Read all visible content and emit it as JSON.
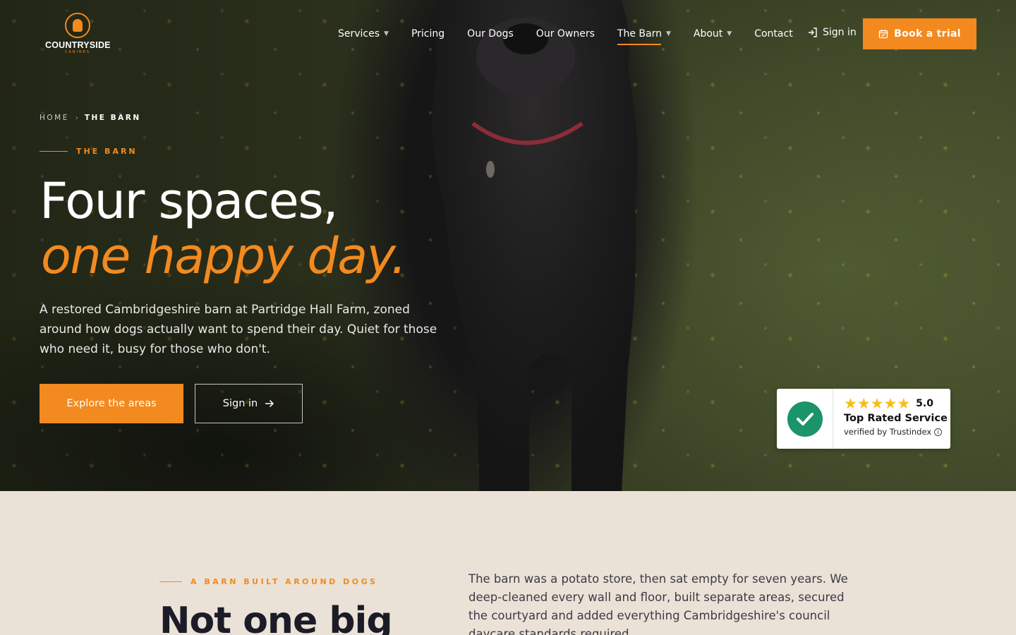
{
  "brand": {
    "name": "COUNTRYSIDE",
    "sub": "CANINES",
    "accent_color": "#f28a1f"
  },
  "nav": {
    "items": [
      {
        "label": "Services",
        "has_dropdown": true
      },
      {
        "label": "Pricing",
        "has_dropdown": false
      },
      {
        "label": "Our Dogs",
        "has_dropdown": false
      },
      {
        "label": "Our Owners",
        "has_dropdown": false
      },
      {
        "label": "The Barn",
        "has_dropdown": true,
        "active": true
      },
      {
        "label": "About",
        "has_dropdown": true
      },
      {
        "label": "Contact",
        "has_dropdown": false
      }
    ],
    "signin_label": "Sign in",
    "cta_label": "Book a trial"
  },
  "hero": {
    "breadcrumb": {
      "home": "HOME",
      "current": "THE BARN"
    },
    "eyebrow": "THE BARN",
    "title_line1": "Four spaces,",
    "title_line2": "one happy day.",
    "lede": "A restored Cambridgeshire barn at Partridge Hall Farm, zoned around how dogs actually want to spend their day. Quiet for those who need it, busy for those who don't.",
    "primary_button": "Explore the areas",
    "secondary_button": "Sign in"
  },
  "trust_badge": {
    "score": "5.0",
    "stars": 5,
    "title": "Top Rated Service",
    "verified": "verified by Trustindex",
    "check_color": "#1b9469"
  },
  "section": {
    "eyebrow": "A BARN BUILT AROUND DOGS",
    "heading": "Not one big",
    "body": "The barn was a potato store, then sat empty for seven years. We deep-cleaned every wall and floor, built separate areas, secured the courtyard and added everything Cambridgeshire's council daycare standards required."
  }
}
